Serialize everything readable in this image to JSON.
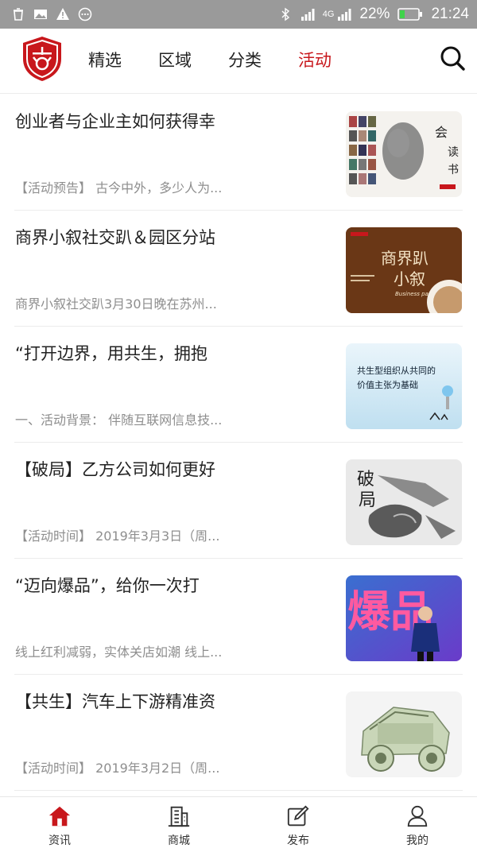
{
  "status_bar": {
    "icons": [
      "trash-icon",
      "image-icon",
      "warning-icon",
      "more-circle-icon",
      "bluetooth-icon",
      "signal-icon",
      "4g-signal-icon",
      "battery-icon"
    ],
    "network": "4G",
    "battery": "22%",
    "time": "21:24"
  },
  "header": {
    "tabs": [
      {
        "label": "精选",
        "active": false
      },
      {
        "label": "区域",
        "active": false
      },
      {
        "label": "分类",
        "active": false
      },
      {
        "label": "活动",
        "active": true
      }
    ],
    "accent": "#c8171c"
  },
  "articles": [
    {
      "title": "创业者与企业主如何获得幸",
      "summary": "【活动预告】 古今中外，多少人为..."
    },
    {
      "title": "商界小叙社交趴＆园区分站",
      "summary": "商界小叙社交趴3月30日晚在苏州..."
    },
    {
      "title": "“打开边界，用共生，拥抱",
      "summary": "一、活动背景： 伴随互联网信息技..."
    },
    {
      "title": "【破局】乙方公司如何更好",
      "summary": "【活动时间】 2019年3月3日（周..."
    },
    {
      "title": "“迈向爆品”，给你一次打",
      "summary": "线上红利减弱，实体关店如潮 线上..."
    },
    {
      "title": "【共生】汽车上下游精准资",
      "summary": "【活动时间】 2019年3月2日（周..."
    }
  ],
  "thumbs": {
    "t1_text": "会读书",
    "t2_text": "商界小叙",
    "t2_sub": "Business party",
    "t3_text": "共生型组织从共同的价值主张为基础",
    "t4_text": "破局",
    "t5_text": "爆品"
  },
  "bottom_nav": [
    {
      "label": "资讯",
      "icon": "home-icon",
      "active": true
    },
    {
      "label": "商城",
      "icon": "building-icon",
      "active": false
    },
    {
      "label": "发布",
      "icon": "edit-icon",
      "active": false
    },
    {
      "label": "我的",
      "icon": "user-icon",
      "active": false
    }
  ]
}
